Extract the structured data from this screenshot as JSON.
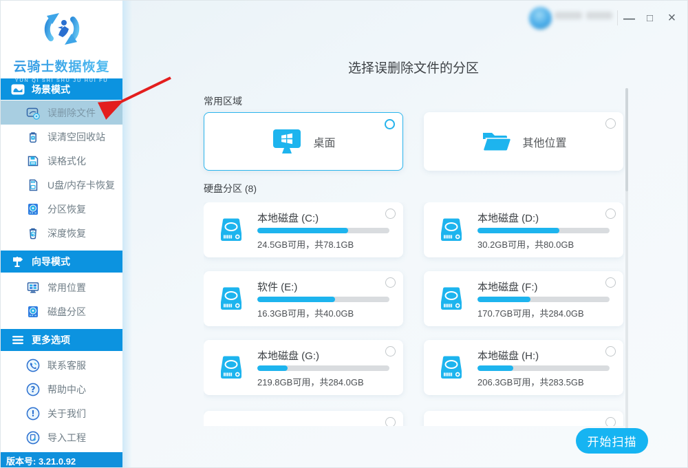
{
  "window": {
    "icons": {
      "minimize": "—",
      "maximize": "□",
      "close": "×"
    }
  },
  "logo": {
    "title": "云骑士数据恢复",
    "subtitle": "YUN QI SHI SHU JU HUI FU"
  },
  "sidebar": {
    "sections": [
      {
        "label": "场景模式",
        "items": [
          {
            "label": "误删除文件",
            "selected": true
          },
          {
            "label": "误清空回收站"
          },
          {
            "label": "误格式化"
          },
          {
            "label": "U盘/内存卡恢复"
          },
          {
            "label": "分区恢复"
          },
          {
            "label": "深度恢复"
          }
        ]
      },
      {
        "label": "向导模式",
        "items": [
          {
            "label": "常用位置"
          },
          {
            "label": "磁盘分区"
          }
        ]
      },
      {
        "label": "更多选项",
        "items": [
          {
            "label": "联系客服"
          },
          {
            "label": "帮助中心"
          },
          {
            "label": "关于我们"
          },
          {
            "label": "导入工程"
          }
        ]
      }
    ],
    "version": "版本号: 3.21.0.92"
  },
  "main": {
    "title": "选择误删除文件的分区",
    "common_label": "常用区域",
    "common_items": [
      {
        "label": "桌面",
        "selected": true
      },
      {
        "label": "其他位置",
        "selected": false
      }
    ],
    "disks_label": "硬盘分区 (8)",
    "disks": [
      {
        "name": "本地磁盘 (C:)",
        "info": "24.5GB可用，共78.1GB",
        "used_pct": "69%"
      },
      {
        "name": "本地磁盘 (D:)",
        "info": "30.2GB可用，共80.0GB",
        "used_pct": "62%"
      },
      {
        "name": "软件 (E:)",
        "info": "16.3GB可用，共40.0GB",
        "used_pct": "59%"
      },
      {
        "name": "本地磁盘 (F:)",
        "info": "170.7GB可用，共284.0GB",
        "used_pct": "40%"
      },
      {
        "name": "本地磁盘 (G:)",
        "info": "219.8GB可用，共284.0GB",
        "used_pct": "23%"
      },
      {
        "name": "本地磁盘 (H:)",
        "info": "206.3GB可用，共283.5GB",
        "used_pct": "27%"
      }
    ],
    "scan_button": "开始扫描"
  },
  "colors": {
    "accent_cyan": "#1db4ee",
    "header_blue": "#0c93e0",
    "selected_item_bg": "#a8cee1",
    "annotation_red": "#e31e1e"
  }
}
